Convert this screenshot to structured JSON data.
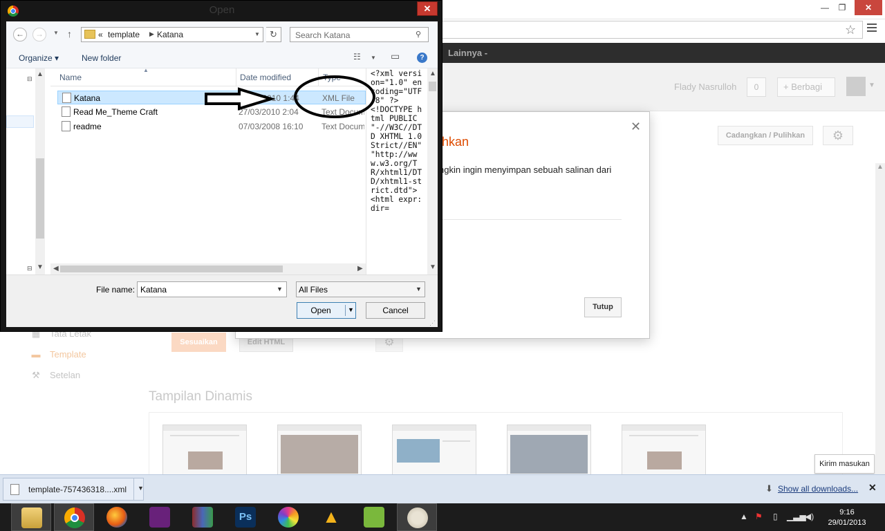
{
  "browser": {
    "lainnya_label": "Lainnya -",
    "user_name": "Flady Nasrulloh",
    "notif_count": "0",
    "share_label": "+ Berbagi",
    "backup_restore_label": "Cadangkan / Pulihkan",
    "win_min": "—",
    "win_max": "❐",
    "win_close": "✕"
  },
  "sidebar": {
    "items": [
      {
        "label": "Tata Letak",
        "icon": "layout-icon"
      },
      {
        "label": "Template",
        "icon": "template-icon"
      },
      {
        "label": "Setelan",
        "icon": "wrench-icon"
      }
    ]
  },
  "template_page": {
    "customize_label": "Sesuaikan",
    "edit_html_label": "Edit HTML",
    "dynamic_views_title": "Tampilan Dinamis"
  },
  "backup_modal": {
    "title_fragment": "ihkan",
    "text_fragment": "ngkin ingin menyimpan sebuah salinan dari",
    "close_label": "Tutup",
    "x_label": "✕"
  },
  "feedback_label": "Kirim masukan",
  "download_bar": {
    "file_name": "template-757436318....xml",
    "show_all_label": "Show all downloads...",
    "close_label": "✕"
  },
  "taskbar": {
    "time": "9:16",
    "date": "29/01/2013",
    "apps": [
      "file-explorer-icon",
      "chrome-icon",
      "firefox-icon",
      "visual-studio-icon",
      "winrar-icon",
      "photoshop-icon",
      "picasa-icon",
      "vlc-style-icon",
      "app-icon",
      "paint-icon"
    ]
  },
  "open_dialog": {
    "title": "Open",
    "close": "✕",
    "path": [
      "«",
      "template",
      "Katana"
    ],
    "search_placeholder": "Search Katana",
    "organize_label": "Organize ▾",
    "new_folder_label": "New folder",
    "columns": {
      "name": "Name",
      "date": "Date modified",
      "type": "Type"
    },
    "files": [
      {
        "name": "Katana",
        "date": "07/03/2010 1:44",
        "type": "XML File",
        "selected": true
      },
      {
        "name": "Read Me_Theme Craft",
        "date": "27/03/2010 2:04",
        "type": "Text Document",
        "selected": false
      },
      {
        "name": "readme",
        "date": "07/03/2008 16:10",
        "type": "Text Document",
        "selected": false
      }
    ],
    "preview_text": "<?xml version=\"1.0\" encoding=\"UTF-8\" ?>\n<!DOCTYPE html PUBLIC \"-//W3C//DTD XHTML 1.0 Strict//EN\" \"http://www.w3.org/TR/xhtml1/DTD/xhtml1-strict.dtd\">\n<html expr:dir=",
    "file_name_label": "File name:",
    "file_name_value": "Katana",
    "file_type_value": "All Files",
    "open_label": "Open",
    "cancel_label": "Cancel"
  }
}
